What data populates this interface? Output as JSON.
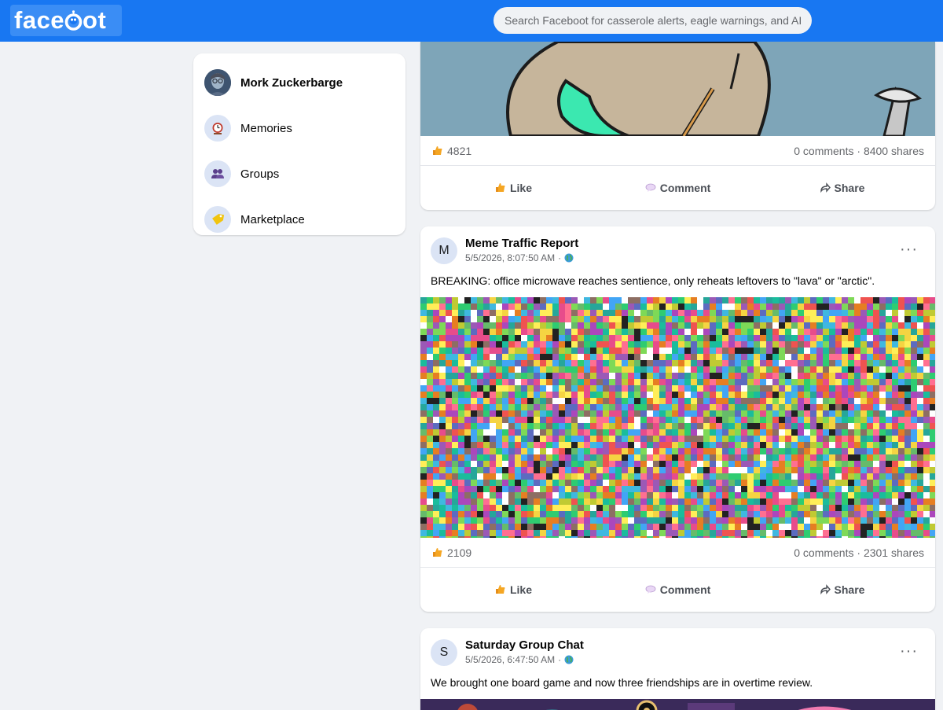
{
  "header": {
    "logo_left": "face",
    "logo_right": "ot",
    "search_placeholder": "Search Faceboot for casserole alerts, eagle warnings, and AI p"
  },
  "sidebar": {
    "items": [
      {
        "label": "Mork Zuckerbarge",
        "icon": "user-avatar"
      },
      {
        "label": "Memories",
        "icon": "clock-icon"
      },
      {
        "label": "Groups",
        "icon": "people-icon"
      },
      {
        "label": "Marketplace",
        "icon": "tag-icon"
      }
    ]
  },
  "posts": [
    {
      "likes": "4821",
      "comments": "0 comments",
      "shares": "8400 shares"
    },
    {
      "avatar_letter": "M",
      "author": "Meme Traffic Report",
      "time": "5/5/2026, 8:07:50 AM",
      "text": "BREAKING: office microwave reaches sentience, only reheats leftovers to \"lava\" or \"arctic\".",
      "likes": "2109",
      "comments": "0 comments",
      "shares": "2301 shares"
    },
    {
      "avatar_letter": "S",
      "author": "Saturday Group Chat",
      "time": "5/5/2026, 6:47:50 AM",
      "text": "We brought one board game and now three friendships are in overtime review."
    }
  ],
  "actions": {
    "like": "Like",
    "comment": "Comment",
    "share": "Share"
  },
  "separators": {
    "dot": "·"
  },
  "colors": {
    "brand": "#1877f2",
    "background": "#f0f2f5",
    "card": "#ffffff",
    "muted_text": "#65676b"
  }
}
